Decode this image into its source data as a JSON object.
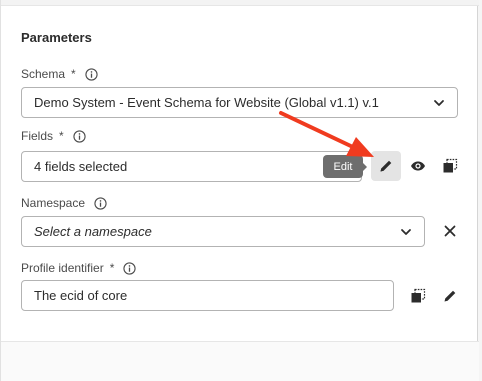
{
  "section": {
    "title": "Parameters"
  },
  "schema": {
    "label": "Schema",
    "required": "*",
    "value": "Demo System - Event Schema for Website (Global v1.1) v.1"
  },
  "fields": {
    "label": "Fields",
    "required": "*",
    "value": "4 fields selected",
    "tooltip": "Edit"
  },
  "namespace": {
    "label": "Namespace",
    "placeholder": "Select a namespace"
  },
  "profile_identifier": {
    "label": "Profile identifier",
    "required": "*",
    "value": "The ecid of core"
  },
  "colors": {
    "annotation_arrow": "#f03b1f",
    "tooltip_bg": "#6e6e6e",
    "border": "#b3b3b3"
  },
  "icons": [
    "info-icon",
    "chevron-down-icon",
    "pencil-icon",
    "eye-icon",
    "copy-icon",
    "close-icon"
  ]
}
